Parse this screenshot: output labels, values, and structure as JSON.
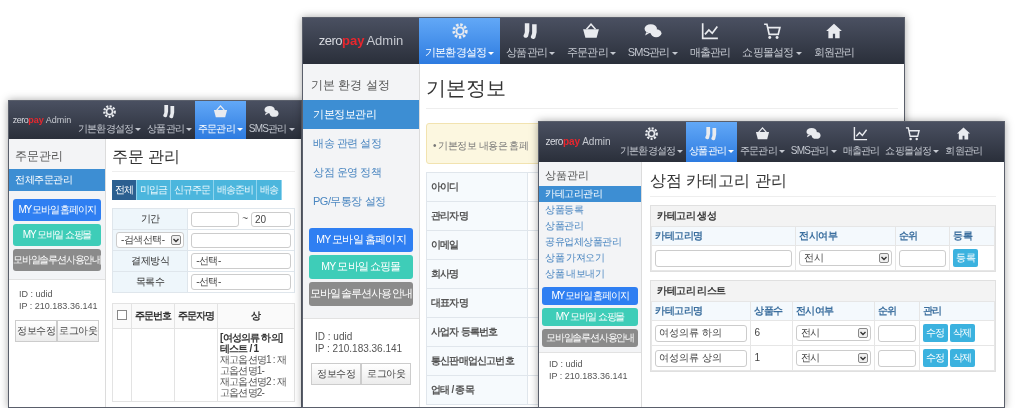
{
  "windows": [
    {
      "kind": "orders",
      "logo": {
        "brand": "zero",
        "accent": "pay",
        "suffix": "Admin"
      },
      "nav": [
        {
          "label": "기본환경설정",
          "has_menu": true,
          "selected": false
        },
        {
          "label": "상품관리",
          "has_menu": true,
          "selected": false
        },
        {
          "label": "주문관리",
          "has_menu": true,
          "selected": true
        },
        {
          "label": "SMS관리",
          "has_menu": true,
          "selected": false
        }
      ],
      "sidebar": {
        "heading": "주문관리",
        "items": [
          {
            "label": "전체주문관리",
            "selected": true
          }
        ]
      },
      "promo_buttons": [
        {
          "label": "MY 모바일 홈페이지",
          "kind": "homepage"
        },
        {
          "label": "MY 모바일 쇼핑몰",
          "kind": "shop"
        },
        {
          "label": "모바일솔루션사용안내",
          "kind": "guide"
        }
      ],
      "user": {
        "id": "ID : udid",
        "ip": "IP : 210.183.36.141",
        "buttons": [
          "정보수정",
          "로그아웃"
        ]
      },
      "title": "주문 관리",
      "tabs": [
        {
          "label": "전체",
          "selected": true
        },
        {
          "label": "미입금",
          "selected": false
        },
        {
          "label": "신규주문",
          "selected": false
        },
        {
          "label": "배송준비",
          "selected": false
        },
        {
          "label": "배송",
          "selected": false
        }
      ],
      "filters": [
        {
          "kind": "date_range",
          "label": "기간",
          "separator": "~",
          "end_value": "20"
        },
        {
          "kind": "search",
          "select_value": "-검색선택-"
        },
        {
          "kind": "select",
          "label": "결제방식",
          "value": "-선택-"
        },
        {
          "kind": "select",
          "label": "목록수",
          "value": "-선택-"
        }
      ],
      "orders_table": {
        "columns": [
          "주문번호",
          "주문자명",
          "상"
        ],
        "header_checked": false,
        "rows": [
          {
            "product_lines": [
              "[여성의류 하의] 테스트 / 1",
              "재고옵션명1 : 재고옵션명1-",
              "재고옵션명2 : 재고옵션명2-"
            ]
          }
        ]
      }
    },
    {
      "kind": "basic_info",
      "logo": {
        "brand": "zero",
        "accent": "pay",
        "suffix": "Admin"
      },
      "nav": [
        {
          "label": "기본환경설정",
          "has_menu": true,
          "selected": true
        },
        {
          "label": "상품관리",
          "has_menu": true,
          "selected": false
        },
        {
          "label": "주문관리",
          "has_menu": true,
          "selected": false
        },
        {
          "label": "SMS관리",
          "has_menu": true,
          "selected": false
        },
        {
          "label": "매출관리",
          "has_menu": false,
          "selected": false
        },
        {
          "label": "쇼핑몰설정",
          "has_menu": true,
          "selected": false
        },
        {
          "label": "회원관리",
          "has_menu": false,
          "selected": false
        }
      ],
      "sidebar": {
        "heading": "기본 환경 설정",
        "items": [
          {
            "label": "기본정보관리",
            "selected": true
          },
          {
            "label": "배송 관련 설정",
            "selected": false
          },
          {
            "label": "상점 운영 정책",
            "selected": false
          },
          {
            "label": "PG/무통장 설정",
            "selected": false
          }
        ]
      },
      "promo_buttons": [
        {
          "label": "MY 모바일 홈페이지",
          "kind": "homepage"
        },
        {
          "label": "MY 모바일 쇼핑몰",
          "kind": "shop"
        },
        {
          "label": "모바일솔루션사용안내",
          "kind": "guide"
        }
      ],
      "user": {
        "id": "ID : udid",
        "ip": "IP : 210.183.36.141",
        "buttons": [
          "정보수정",
          "로그아웃"
        ]
      },
      "title": "기본정보",
      "notice": "• 기본정보 내용은 홈페",
      "field_labels": [
        "아이디",
        "관리자명",
        "이메일",
        "회사명",
        "대표자명",
        "사업자 등록번호",
        "통신판매업신고번호",
        "업태 / 종목"
      ]
    },
    {
      "kind": "category",
      "logo": {
        "brand": "zero",
        "accent": "pay",
        "suffix": "Admin"
      },
      "nav": [
        {
          "label": "기본환경설정",
          "has_menu": true,
          "selected": false
        },
        {
          "label": "상품관리",
          "has_menu": true,
          "selected": true
        },
        {
          "label": "주문관리",
          "has_menu": true,
          "selected": false
        },
        {
          "label": "SMS관리",
          "has_menu": true,
          "selected": false
        },
        {
          "label": "매출관리",
          "has_menu": false,
          "selected": false
        },
        {
          "label": "쇼핑몰설정",
          "has_menu": true,
          "selected": false
        },
        {
          "label": "회원관리",
          "has_menu": false,
          "selected": false
        }
      ],
      "sidebar": {
        "heading": "상품관리",
        "items": [
          {
            "label": "카테고리관리",
            "selected": true
          },
          {
            "label": "상품등록",
            "selected": false
          },
          {
            "label": "상품관리",
            "selected": false
          },
          {
            "label": "공유업체상품관리",
            "selected": false
          },
          {
            "label": "상품 가져오기",
            "selected": false
          },
          {
            "label": "상품 내보내기",
            "selected": false
          }
        ]
      },
      "promo_buttons": [
        {
          "label": "MY 모바일 홈페이지",
          "kind": "homepage"
        },
        {
          "label": "MY 모바일 쇼핑몰",
          "kind": "shop"
        },
        {
          "label": "모바일솔루션사용안내",
          "kind": "guide"
        }
      ],
      "user": {
        "id": "ID : udid",
        "ip": "IP : 210.183.36.141"
      },
      "title": "상점 카테고리 관리",
      "create_panel": {
        "heading": "카테고리 생성",
        "columns": [
          "카테고리명",
          "전시여부",
          "순위",
          "등록"
        ],
        "display_value": "전시",
        "button": "등록"
      },
      "list_panel": {
        "heading": "카테고리 리스트",
        "columns": [
          "카테고리명",
          "상품수",
          "전시여부",
          "순위",
          "관리"
        ],
        "rows": [
          {
            "name": "여성의류 하의",
            "count": "6",
            "display": "전시",
            "buttons": [
              "수정",
              "삭제"
            ]
          },
          {
            "name": "여성의류 상의",
            "count": "1",
            "display": "전시",
            "buttons": [
              "수정",
              "삭제"
            ]
          }
        ]
      }
    }
  ]
}
